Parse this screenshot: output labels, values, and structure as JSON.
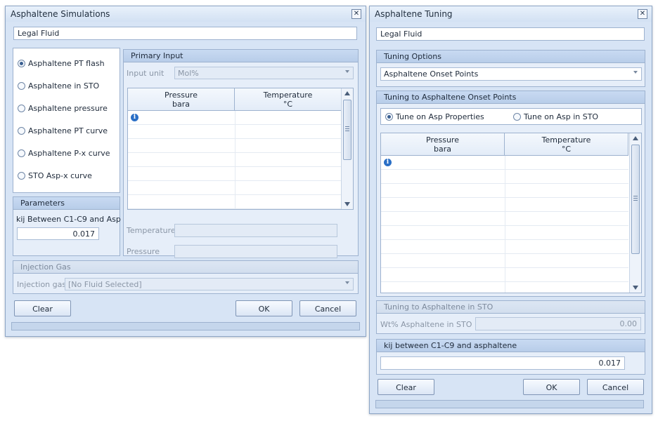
{
  "sim": {
    "title": "Asphaltene Simulations",
    "fluid": "Legal Fluid",
    "options": [
      "Asphaltene PT flash",
      "Asphaltene in STO",
      "Asphaltene pressure",
      "Asphaltene PT curve",
      "Asphaltene P-x curve",
      "STO Asp-x curve"
    ],
    "selected_option": 0,
    "parameters": {
      "header": "Parameters",
      "kij_label": "kij Between C1-C9 and Asp",
      "kij_value": "0.017"
    },
    "primary_input": {
      "header": "Primary Input",
      "input_unit_label": "Input unit",
      "input_unit_value": "Mol%",
      "columns": [
        {
          "name": "Pressure",
          "unit": "bara"
        },
        {
          "name": "Temperature",
          "unit": "°C"
        }
      ],
      "temperature_label": "Temperature",
      "pressure_label": "Pressure"
    },
    "injection": {
      "header": "Injection Gas",
      "label": "Injection gas",
      "value": "[No Fluid Selected]"
    },
    "buttons": {
      "clear": "Clear",
      "ok": "OK",
      "cancel": "Cancel"
    }
  },
  "tune": {
    "title": "Asphaltene Tuning",
    "fluid": "Legal Fluid",
    "tuning_options": {
      "header": "Tuning Options",
      "value": "Asphaltene Onset Points"
    },
    "onset": {
      "header": "Tuning to Asphaltene Onset Points",
      "radio_props": "Tune on Asp Properties",
      "radio_sto": "Tune on Asp in STO",
      "columns": [
        {
          "name": "Pressure",
          "unit": "bara"
        },
        {
          "name": "Temperature",
          "unit": "°C"
        }
      ]
    },
    "sto": {
      "header": "Tuning to Asphaltene in STO",
      "label": "Wt% Asphaltene in STO",
      "value": "0.00"
    },
    "kij": {
      "header": "kij between C1-C9 and asphaltene",
      "value": "0.017"
    },
    "buttons": {
      "clear": "Clear",
      "ok": "OK",
      "cancel": "Cancel"
    }
  },
  "colors": {
    "window_bg": "#d7e4f5",
    "header_bg": "#c8daf2",
    "info_icon": "#2a6fc6"
  }
}
